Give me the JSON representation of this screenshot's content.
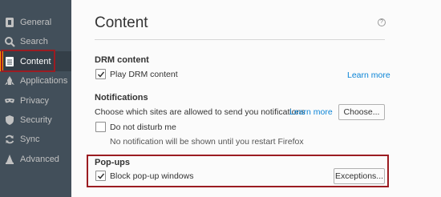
{
  "sidebar": {
    "items": [
      {
        "label": "General",
        "icon": "general-icon"
      },
      {
        "label": "Search",
        "icon": "search-icon"
      },
      {
        "label": "Content",
        "icon": "content-icon"
      },
      {
        "label": "Applications",
        "icon": "applications-icon"
      },
      {
        "label": "Privacy",
        "icon": "privacy-mask-icon"
      },
      {
        "label": "Security",
        "icon": "security-shield-icon"
      },
      {
        "label": "Sync",
        "icon": "sync-icon"
      },
      {
        "label": "Advanced",
        "icon": "advanced-wizard-icon"
      }
    ],
    "active": "Content"
  },
  "main": {
    "title": "Content",
    "help": "?",
    "drm": {
      "heading": "DRM content",
      "checkbox_label": "Play DRM content",
      "checked": true,
      "learn_more": "Learn more"
    },
    "notifications": {
      "heading": "Notifications",
      "description": "Choose which sites are allowed to send you notifications",
      "learn_more": "Learn more",
      "choose_button": "Choose...",
      "dnd_label": "Do not disturb me",
      "dnd_checked": false,
      "dnd_note": "No notification will be shown until you restart Firefox"
    },
    "popups": {
      "heading": "Pop-ups",
      "checkbox_label": "Block pop-up windows",
      "checked": true,
      "exceptions_button": "Exceptions..."
    }
  },
  "colors": {
    "sidebar_bg": "#424f5a",
    "sidebar_active_bg": "#343f48",
    "accent_link": "#0a84d6",
    "highlight_red": "#9b1c22"
  }
}
